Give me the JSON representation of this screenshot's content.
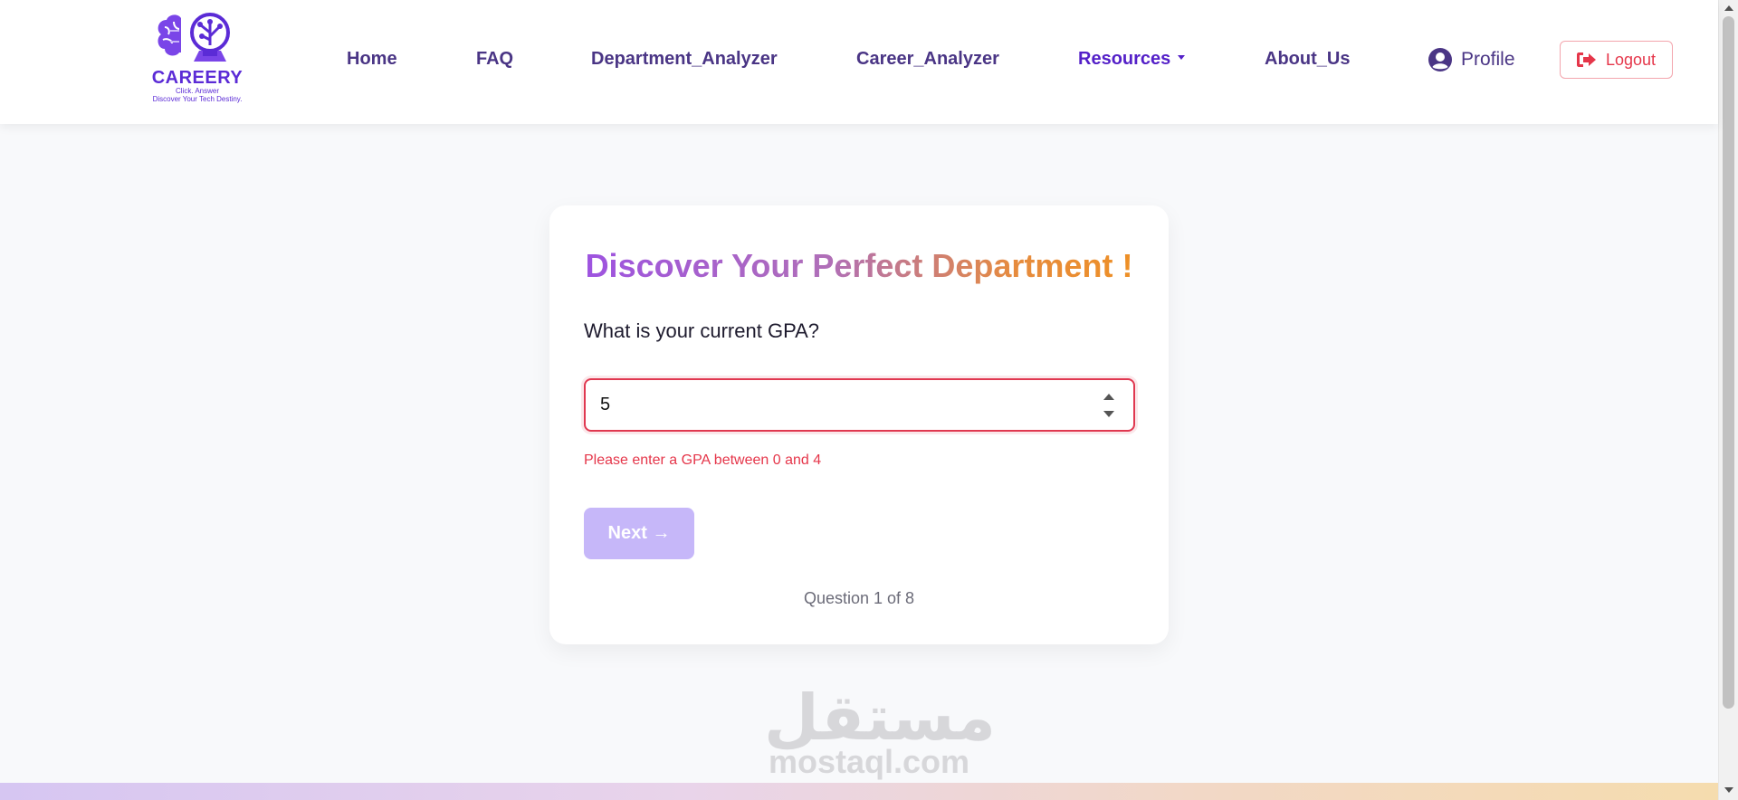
{
  "header": {
    "logo": {
      "name": "CAREERY",
      "tagline1": "Click. Answer",
      "tagline2": "Discover Your Tech Destiny."
    },
    "nav": {
      "home": "Home",
      "faq": "FAQ",
      "department_analyzer": "Department_Analyzer",
      "career_analyzer": "Career_Analyzer",
      "resources": "Resources",
      "about": "About_Us"
    },
    "profile_label": "Profile",
    "logout_label": "Logout"
  },
  "card": {
    "title": "Discover Your Perfect Department !",
    "question": "What is your current GPA?",
    "input_value": "5",
    "error": "Please enter a GPA between 0 and 4",
    "next_label": "Next →",
    "progress": "Question 1 of 8"
  },
  "watermark": {
    "arabic": "مستقل",
    "latin": "mostaql.com"
  },
  "colors": {
    "brand": "#5b2bd6",
    "nav_text": "#4a3585",
    "error": "#e5364a",
    "button_disabled": "#c6b7f9",
    "page_bg": "#f8f9fb"
  },
  "icons": {
    "logo": "brain-lightbulb-icon",
    "profile": "user-circle-icon",
    "logout": "sign-out-icon",
    "resources": "caret-down-icon"
  }
}
